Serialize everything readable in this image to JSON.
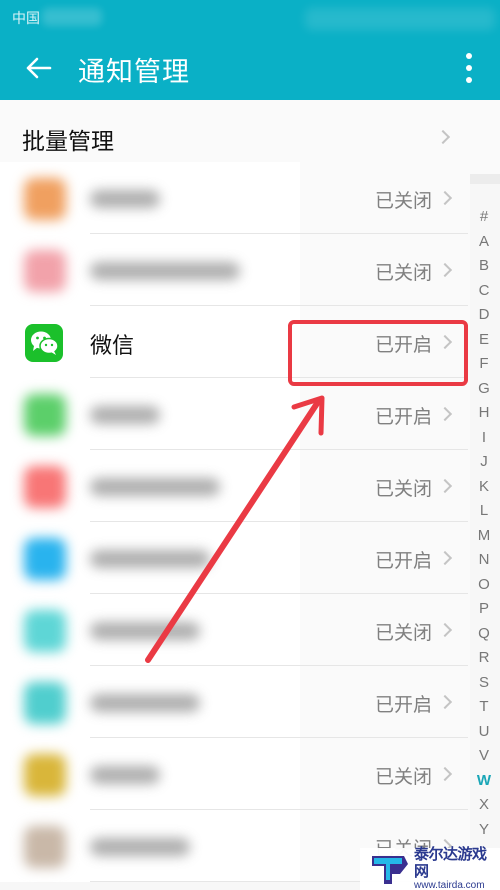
{
  "status_bar": {
    "carrier": "中国"
  },
  "header": {
    "title": "通知管理",
    "back_icon": "arrow-left-icon",
    "menu_icon": "more-vertical-icon",
    "background_color": "#0ab0c6"
  },
  "batch_manage": {
    "label": "批量管理"
  },
  "apps": [
    {
      "name": "",
      "blurred": true,
      "status": "已关闭",
      "icon_color": "#f0a060"
    },
    {
      "name": "",
      "blurred": true,
      "status": "已关闭",
      "icon_color": "#f2a2aa"
    },
    {
      "name": "微信",
      "blurred": false,
      "status": "已开启",
      "icon_color": "#1bc02b",
      "highlighted": true
    },
    {
      "name": "",
      "blurred": true,
      "status": "已开启",
      "icon_color": "#5ccf6a"
    },
    {
      "name": "",
      "blurred": true,
      "status": "已关闭",
      "icon_color": "#f87676"
    },
    {
      "name": "",
      "blurred": true,
      "status": "已开启",
      "icon_color": "#29b3ee"
    },
    {
      "name": "",
      "blurred": true,
      "status": "已关闭",
      "icon_color": "#5ed6d6"
    },
    {
      "name": "",
      "blurred": true,
      "status": "已开启",
      "icon_color": "#50cece"
    },
    {
      "name": "",
      "blurred": true,
      "status": "已关闭",
      "icon_color": "#d9b63a"
    },
    {
      "name": "",
      "blurred": true,
      "status": "已关闭",
      "icon_color": "#c9b8a8"
    }
  ],
  "index_bar": {
    "letters": [
      "#",
      "A",
      "B",
      "C",
      "D",
      "E",
      "F",
      "G",
      "H",
      "I",
      "J",
      "K",
      "L",
      "M",
      "N",
      "O",
      "P",
      "Q",
      "R",
      "S",
      "T",
      "U",
      "V",
      "W",
      "X",
      "Y"
    ],
    "active": "W",
    "active_color": "#1aa6b7"
  },
  "annotation": {
    "highlight_color": "#ea3a44",
    "target": "微信 已开启"
  },
  "watermark": {
    "name": "泰尔达游戏网",
    "url": "www.tairda.com"
  }
}
